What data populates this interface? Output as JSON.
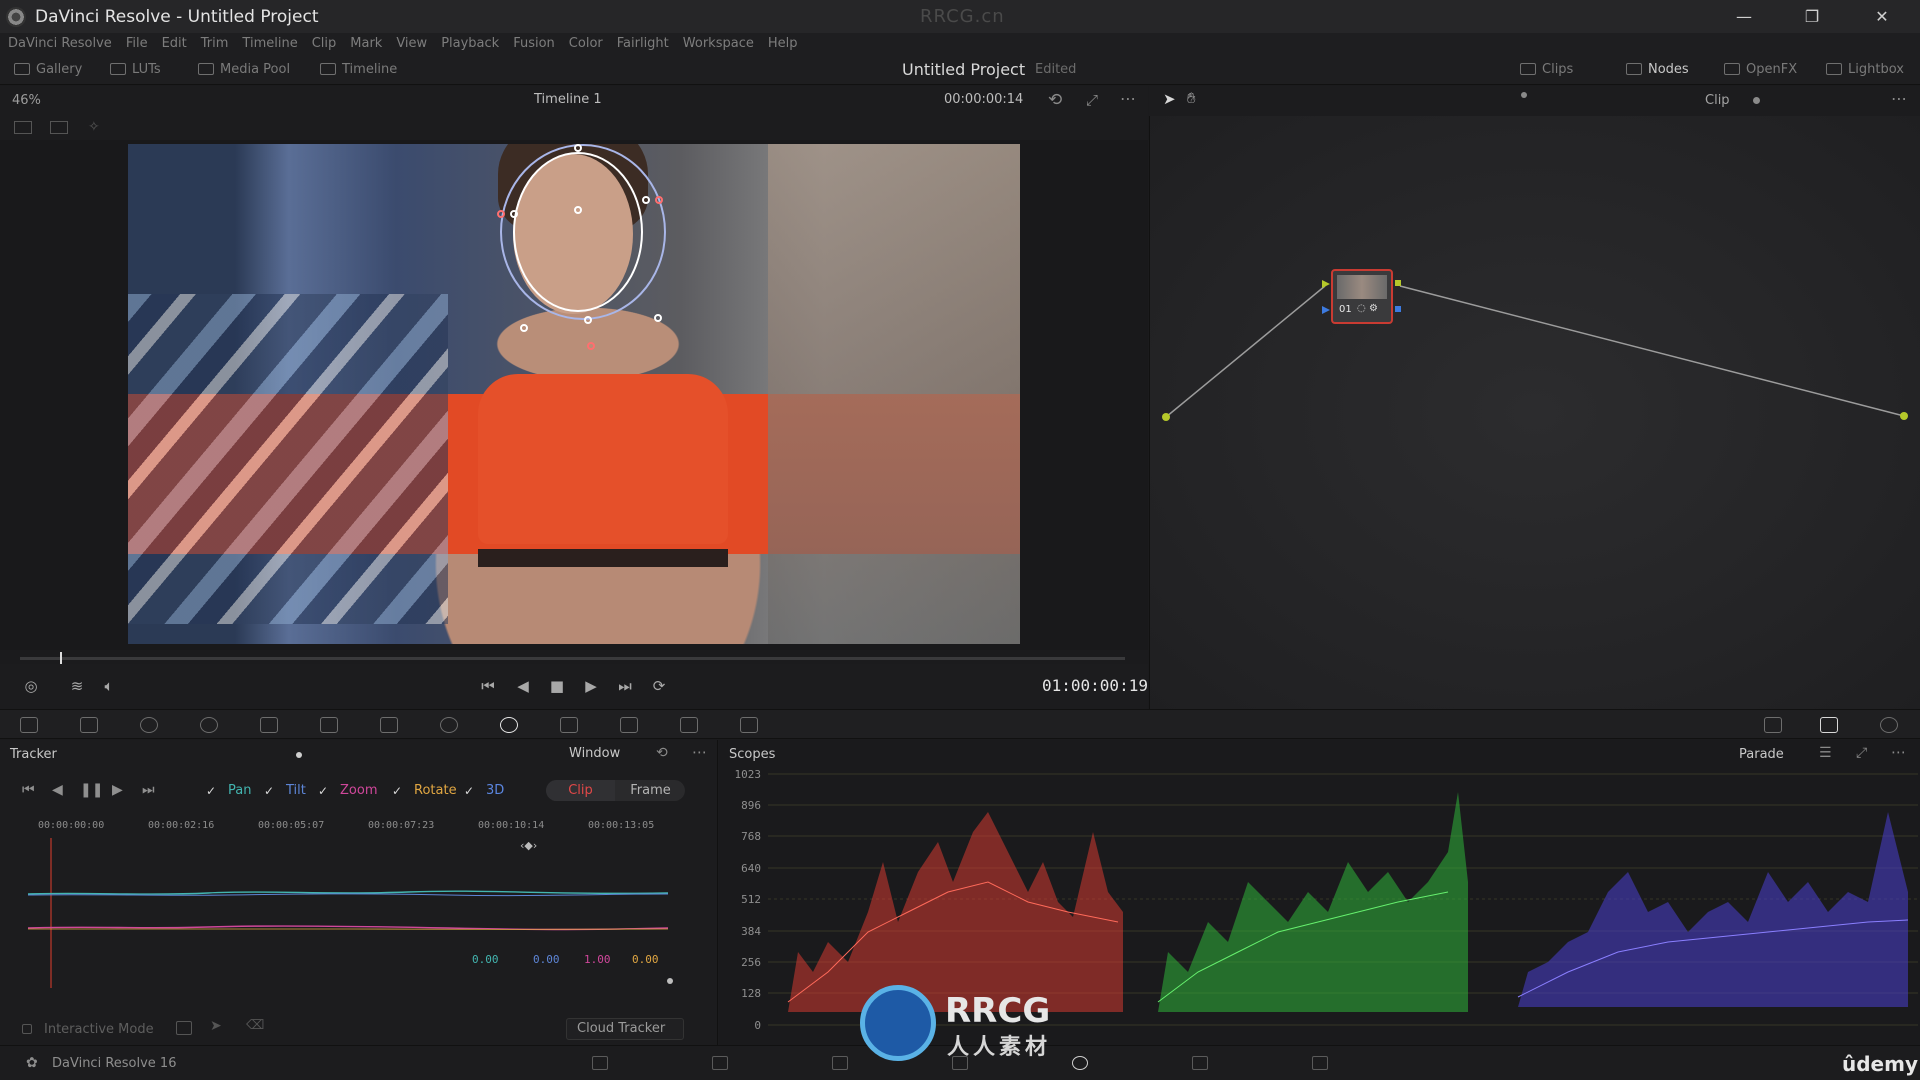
{
  "titlebar": {
    "title": "DaVinci Resolve - Untitled Project",
    "watermark": "RRCG.cn",
    "minimize": "—",
    "restore": "❐",
    "close": "✕"
  },
  "menu": [
    "DaVinci Resolve",
    "File",
    "Edit",
    "Trim",
    "Timeline",
    "Clip",
    "Mark",
    "View",
    "Playback",
    "Fusion",
    "Color",
    "Fairlight",
    "Workspace",
    "Help"
  ],
  "pagebar": {
    "gallery": "Gallery",
    "luts": "LUTs",
    "media_pool": "Media Pool",
    "timeline": "Timeline",
    "project_title": "Untitled Project",
    "project_status": "Edited",
    "clips": "Clips",
    "nodes": "Nodes",
    "openfx": "OpenFX",
    "lightbox": "Lightbox"
  },
  "viewer": {
    "zoom": "46%",
    "timeline_name": "Timeline 1",
    "source_timecode": "00:00:00:14",
    "record_timecode": "01:00:00:19"
  },
  "node_editor": {
    "mode": "Clip",
    "node_label": "01"
  },
  "tracker": {
    "title": "Tracker",
    "mode": "Window",
    "checks": {
      "pan": "Pan",
      "tilt": "Tilt",
      "zoom": "Zoom",
      "rotate": "Rotate",
      "3d": "3D"
    },
    "check_mark": "✓",
    "seg_clip": "Clip",
    "seg_frame": "Frame",
    "ruler": [
      "00:00:00:00",
      "00:00:02:16",
      "00:00:05:07",
      "00:00:07:23",
      "00:00:10:14",
      "00:00:13:05"
    ],
    "values": {
      "pan": "0.00",
      "tilt": "0.00",
      "zoom": "1.00",
      "rotate": "0.00"
    },
    "interactive_mode": "Interactive Mode",
    "cloud_tracker": "Cloud Tracker"
  },
  "scopes": {
    "title": "Scopes",
    "mode": "Parade",
    "yaxis": [
      "1023",
      "896",
      "768",
      "640",
      "512",
      "384",
      "256",
      "128",
      "0"
    ]
  },
  "status": {
    "version": "DaVinci Resolve 16",
    "udemy": "ûdemy"
  },
  "watermark_logo": {
    "text": "RRCG",
    "sub": "人人素材"
  },
  "colors": {
    "pan": "#43b5b0",
    "tilt": "#5d85d6",
    "zoom": "#d0479b",
    "rotate": "#e0a642",
    "3d": "#5b86e0",
    "active_red": "#e04848"
  }
}
